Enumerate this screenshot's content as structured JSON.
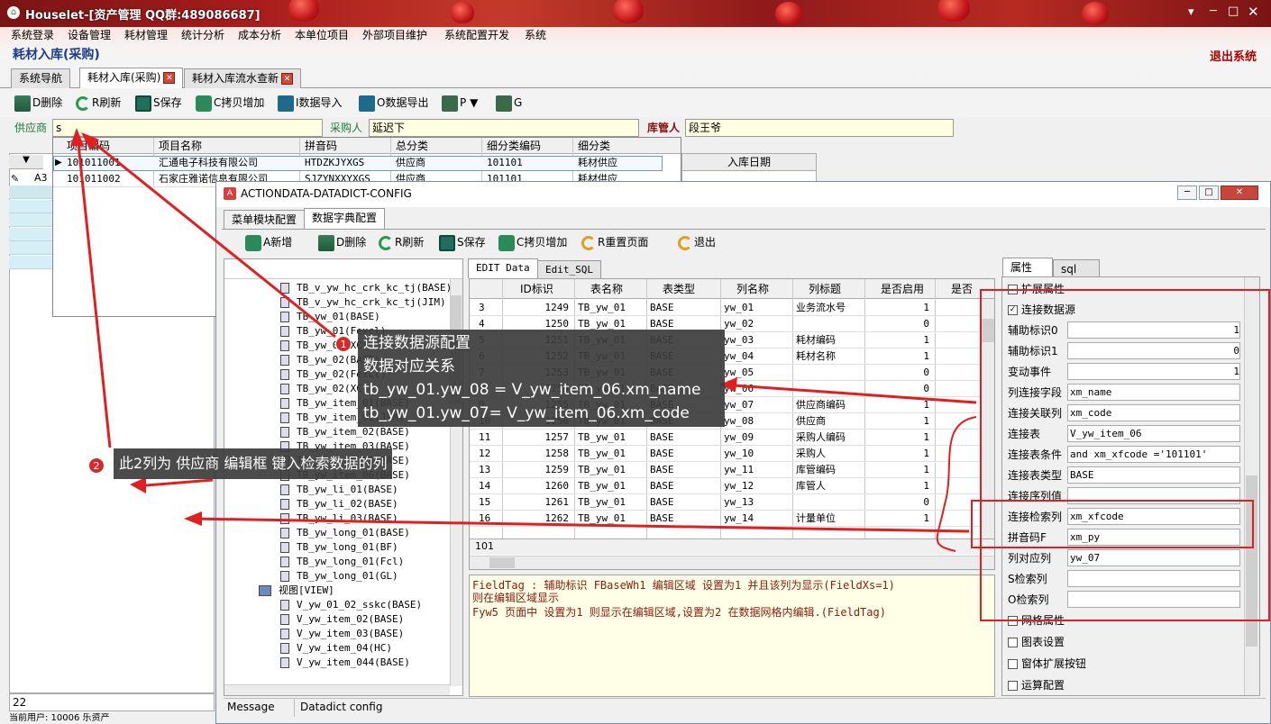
{
  "app": {
    "title": "Houselet-[资产管理 QQ群:489086687]",
    "menu": [
      "系统登录",
      "设备管理",
      "耗材管理",
      "统计分析",
      "成本分析",
      "本单位项目",
      "外部项目维护",
      "系统配置开发",
      "系统"
    ],
    "page_title": "耗材入库(采购)",
    "logout": "退出系统",
    "tabs": [
      "系统导航",
      "耗材入库(采购)",
      "耗材入库流水查新"
    ],
    "toolbar": [
      "D删除",
      "R刷新",
      "S保存",
      "C拷贝增加",
      "I数据导入",
      "O数据导出",
      "P",
      "G"
    ],
    "supplier_label": "供应商",
    "supplier_value": "s",
    "buyer_label": "采购人",
    "buyer_value": "延迟下",
    "keeper_label": "库管人",
    "keeper_value": "段王爷",
    "in_date_col": "入库日期",
    "row_count": "22",
    "status_text": "当前用户: 10006 乐资产"
  },
  "dropdown": {
    "headers": [
      "项目编码",
      "项目名称",
      "拼音码",
      "总分类",
      "细分类编码",
      "细分类"
    ],
    "rows": [
      [
        "101011001",
        "汇通电子科技有限公司",
        "HTDZKJYXGS",
        "供应商",
        "101101",
        "耗材供应"
      ],
      [
        "101011002",
        "石家庄雅诺信息有限公司",
        "SJZYNXXYXGS",
        "供应商",
        "101101",
        "耗材供应"
      ]
    ],
    "left_cell": "A3"
  },
  "dialog": {
    "title": "ACTIONDATA-DATADICT-CONFIG",
    "tabs": [
      "菜单模块配置",
      "数据字典配置"
    ],
    "toolbar": [
      "A新增",
      "D删除",
      "R刷新",
      "S保存",
      "C拷贝增加",
      "R重置页面",
      "退出"
    ],
    "tree": [
      "TB_v_yw_hc_crk_kc_tj(BASE)",
      "TB_v_yw_hc_crk_kc_tj(JIM)",
      "TB_yw_01(BASE)",
      "TB_yw_01(Fexcl)",
      "TB_yw_01(XC)",
      "TB_yw_02(BASE)",
      "TB_yw_02(Fexcl)",
      "TB_yw_02(XC)",
      "TB_yw_item_01(BASE)",
      "TB_yw_item_01(JIM)",
      "TB_yw_item_02(BASE)",
      "TB_yw_item_03(BASE)",
      "TB_yw_item_05(BASE)",
      "TB_yw_item_06(BASE)",
      "TB_yw_li_01(BASE)",
      "TB_yw_li_02(BASE)",
      "TB_yw_li_03(BASE)",
      "TB_yw_long_01(BASE)",
      "TB_yw_long_01(BF)",
      "TB_yw_long_01(Fcl)",
      "TB_yw_long_01(GL)",
      "视图[VIEW]",
      "V_yw_01_02_sskc(BASE)",
      "V_yw_item_02(BASE)",
      "V_yw_item_03(BASE)",
      "V_yw_item_04(HC)",
      "V_yw_item_044(BASE)"
    ],
    "data_tabs": [
      "EDIT Data",
      "Edit_SQL"
    ],
    "grid_headers": [
      "ID标识",
      "表名称",
      "表类型",
      "列名称",
      "列标题",
      "是否启用",
      "是否"
    ],
    "grid_rows": [
      [
        "3",
        "1249",
        "TB_yw_01",
        "BASE",
        "yw_01",
        "业务流水号",
        "1"
      ],
      [
        "4",
        "1250",
        "TB_yw_01",
        "BASE",
        "yw_02",
        "",
        "0"
      ],
      [
        "5",
        "1251",
        "TB_yw_01",
        "BASE",
        "yw_03",
        "耗材编码",
        "1"
      ],
      [
        "6",
        "1252",
        "TB_yw_01",
        "BASE",
        "yw_04",
        "耗材名称",
        "1"
      ],
      [
        "7",
        "1253",
        "TB_yw_01",
        "BASE",
        "yw_05",
        "",
        "0"
      ],
      [
        "8",
        "1254",
        "TB_yw_01",
        "BASE",
        "yw_06",
        "",
        "0"
      ],
      [
        "9",
        "1255",
        "TB_yw_01",
        "BASE",
        "yw_07",
        "供应商编码",
        "1"
      ],
      [
        "10",
        "1256",
        "TB_yw_01",
        "BASE",
        "yw_08",
        "供应商",
        "1"
      ],
      [
        "11",
        "1257",
        "TB_yw_01",
        "BASE",
        "yw_09",
        "采购人编码",
        "1"
      ],
      [
        "12",
        "1258",
        "TB_yw_01",
        "BASE",
        "yw_10",
        "采购人",
        "1"
      ],
      [
        "13",
        "1259",
        "TB_yw_01",
        "BASE",
        "yw_11",
        "库管编码",
        "1"
      ],
      [
        "14",
        "1260",
        "TB_yw_01",
        "BASE",
        "yw_12",
        "库管人",
        "1"
      ],
      [
        "15",
        "1261",
        "TB_yw_01",
        "BASE",
        "yw_13",
        "",
        "0"
      ],
      [
        "16",
        "1262",
        "TB_yw_01",
        "BASE",
        "yw_14",
        "计量单位",
        "1"
      ]
    ],
    "grid_footer": "101",
    "note_lines": [
      "FieldTag : 辅助标识 FBaseWh1 编辑区域 设置为1 并且该列为显示(FieldXs=1)",
      "则在编辑区域显示",
      "Fyw5 页面中 设置为1 则显示在编辑区域,设置为2 在数据网格内编辑.(FieldTag)"
    ],
    "prop_tabs": [
      "属性",
      "sql"
    ],
    "props": [
      {
        "label": "扩展属性",
        "value": ""
      },
      {
        "label": "连接数据源",
        "value": ""
      },
      {
        "label": "辅助标识0",
        "value": "1"
      },
      {
        "label": "辅助标识1",
        "value": "0"
      },
      {
        "label": "变动事件",
        "value": "1"
      },
      {
        "label": "列连接字段",
        "value": "xm_name"
      },
      {
        "label": "连接关联列",
        "value": "xm_code"
      },
      {
        "label": "连接表",
        "value": "V_yw_item_06"
      },
      {
        "label": "连接表条件",
        "value": "and xm_xfcode ='101101'"
      },
      {
        "label": "连接表类型",
        "value": "BASE"
      },
      {
        "label": "连接序列值",
        "value": ""
      },
      {
        "label": "连接检索列",
        "value": "xm_xfcode"
      },
      {
        "label": "拼音码F",
        "value": "xm_py"
      },
      {
        "label": "列对应列",
        "value": "yw_07"
      },
      {
        "label": "S检索列",
        "value": ""
      },
      {
        "label": "O检索列",
        "value": ""
      }
    ],
    "prop_groups": [
      "网格属性",
      "图表设置",
      "窗体扩展按钮",
      "运算配置"
    ],
    "status": [
      "Message",
      "Datadict config"
    ]
  },
  "annotations": {
    "callout1": [
      "连接数据源配置",
      "数据对应关系",
      "tb_yw_01.yw_08 = V_yw_item_06.xm_name",
      "tb_yw_01.yw_07= V_yw_item_06.xm_code"
    ],
    "callout2": "此2列为 供应商 编辑框 键入检索数据的列",
    "badge1": "1",
    "badge2": "2",
    "accent": "#e02020"
  }
}
